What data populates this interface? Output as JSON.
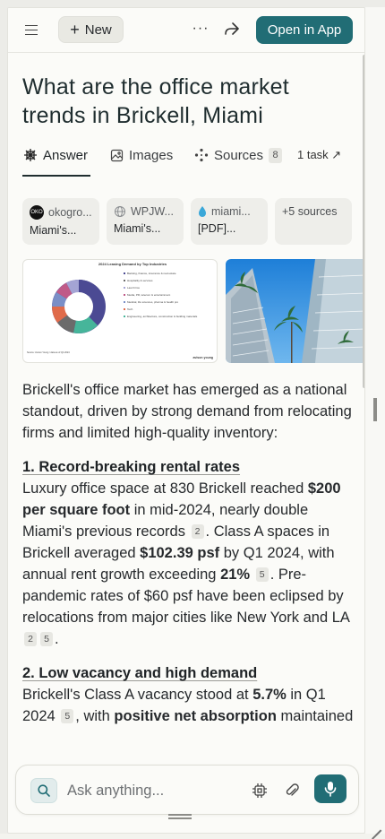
{
  "topbar": {
    "new_label": "New",
    "more_label": "···",
    "open_app_label": "Open in App"
  },
  "page": {
    "title": "What are the office market trends in Brickell, Miami"
  },
  "tabs": {
    "answer": "Answer",
    "images": "Images",
    "sources": "Sources",
    "sources_count": "8",
    "task": "1 task ↗"
  },
  "sources": [
    {
      "site": "okogro...",
      "title": "Miami's..."
    },
    {
      "site": "WPJW...",
      "title": "Miami's..."
    },
    {
      "site": "miami...",
      "title": "[PDF]..."
    },
    {
      "site": "+5 sources",
      "title": ""
    }
  ],
  "images": {
    "chart_title": "2024 Leasing Demand by Top Industries",
    "chart_legend": [
      "Banking, finance, insurance & real estate",
      "Hospitality & services",
      "Law Firms",
      "Media, PR, telecom & entertainment",
      "Medical, life sciences, pharma & health pro",
      "Tech",
      "Engineering, architecture, construction & building materials"
    ],
    "chart_footer": "Source: Avison Young / data as of Q4 2024",
    "chart_brand": "avison young"
  },
  "answer": {
    "intro": "Brickell's office market has emerged as a national standout, driven by strong demand from relocating firms and limited high-quality inventory:",
    "s1_heading": "1. Record-breaking rental rates",
    "s1_t1": "Luxury office space at 830 Brickell reached ",
    "s1_b1": "$200 per square foot",
    "s1_t2": " in mid-2024, nearly double Miami's previous records ",
    "s1_c1": "2",
    "s1_t3": ". Class A spaces in Brickell averaged ",
    "s1_b2": "$102.39 psf",
    "s1_t4": " by Q1 2024, with annual rent growth exceeding ",
    "s1_b3": "21%",
    "s1_c2": "5",
    "s1_t5": ". Pre-pandemic rates of $60 psf have been eclipsed by relocations from major cities like New York and LA ",
    "s1_c3": "2",
    "s1_c4": "5",
    "s1_t6": ".",
    "s2_heading": "2. Low vacancy and high demand",
    "s2_t1": "Brickell's Class A vacancy stood at ",
    "s2_b1": "5.7%",
    "s2_t2": " in Q1 2024 ",
    "s2_c1": "5",
    "s2_t3": ", with ",
    "s2_b2": "positive net absorption",
    "s2_t4": " maintained"
  },
  "ask": {
    "placeholder": "Ask anything..."
  },
  "colors": {
    "accent": "#216d75"
  }
}
